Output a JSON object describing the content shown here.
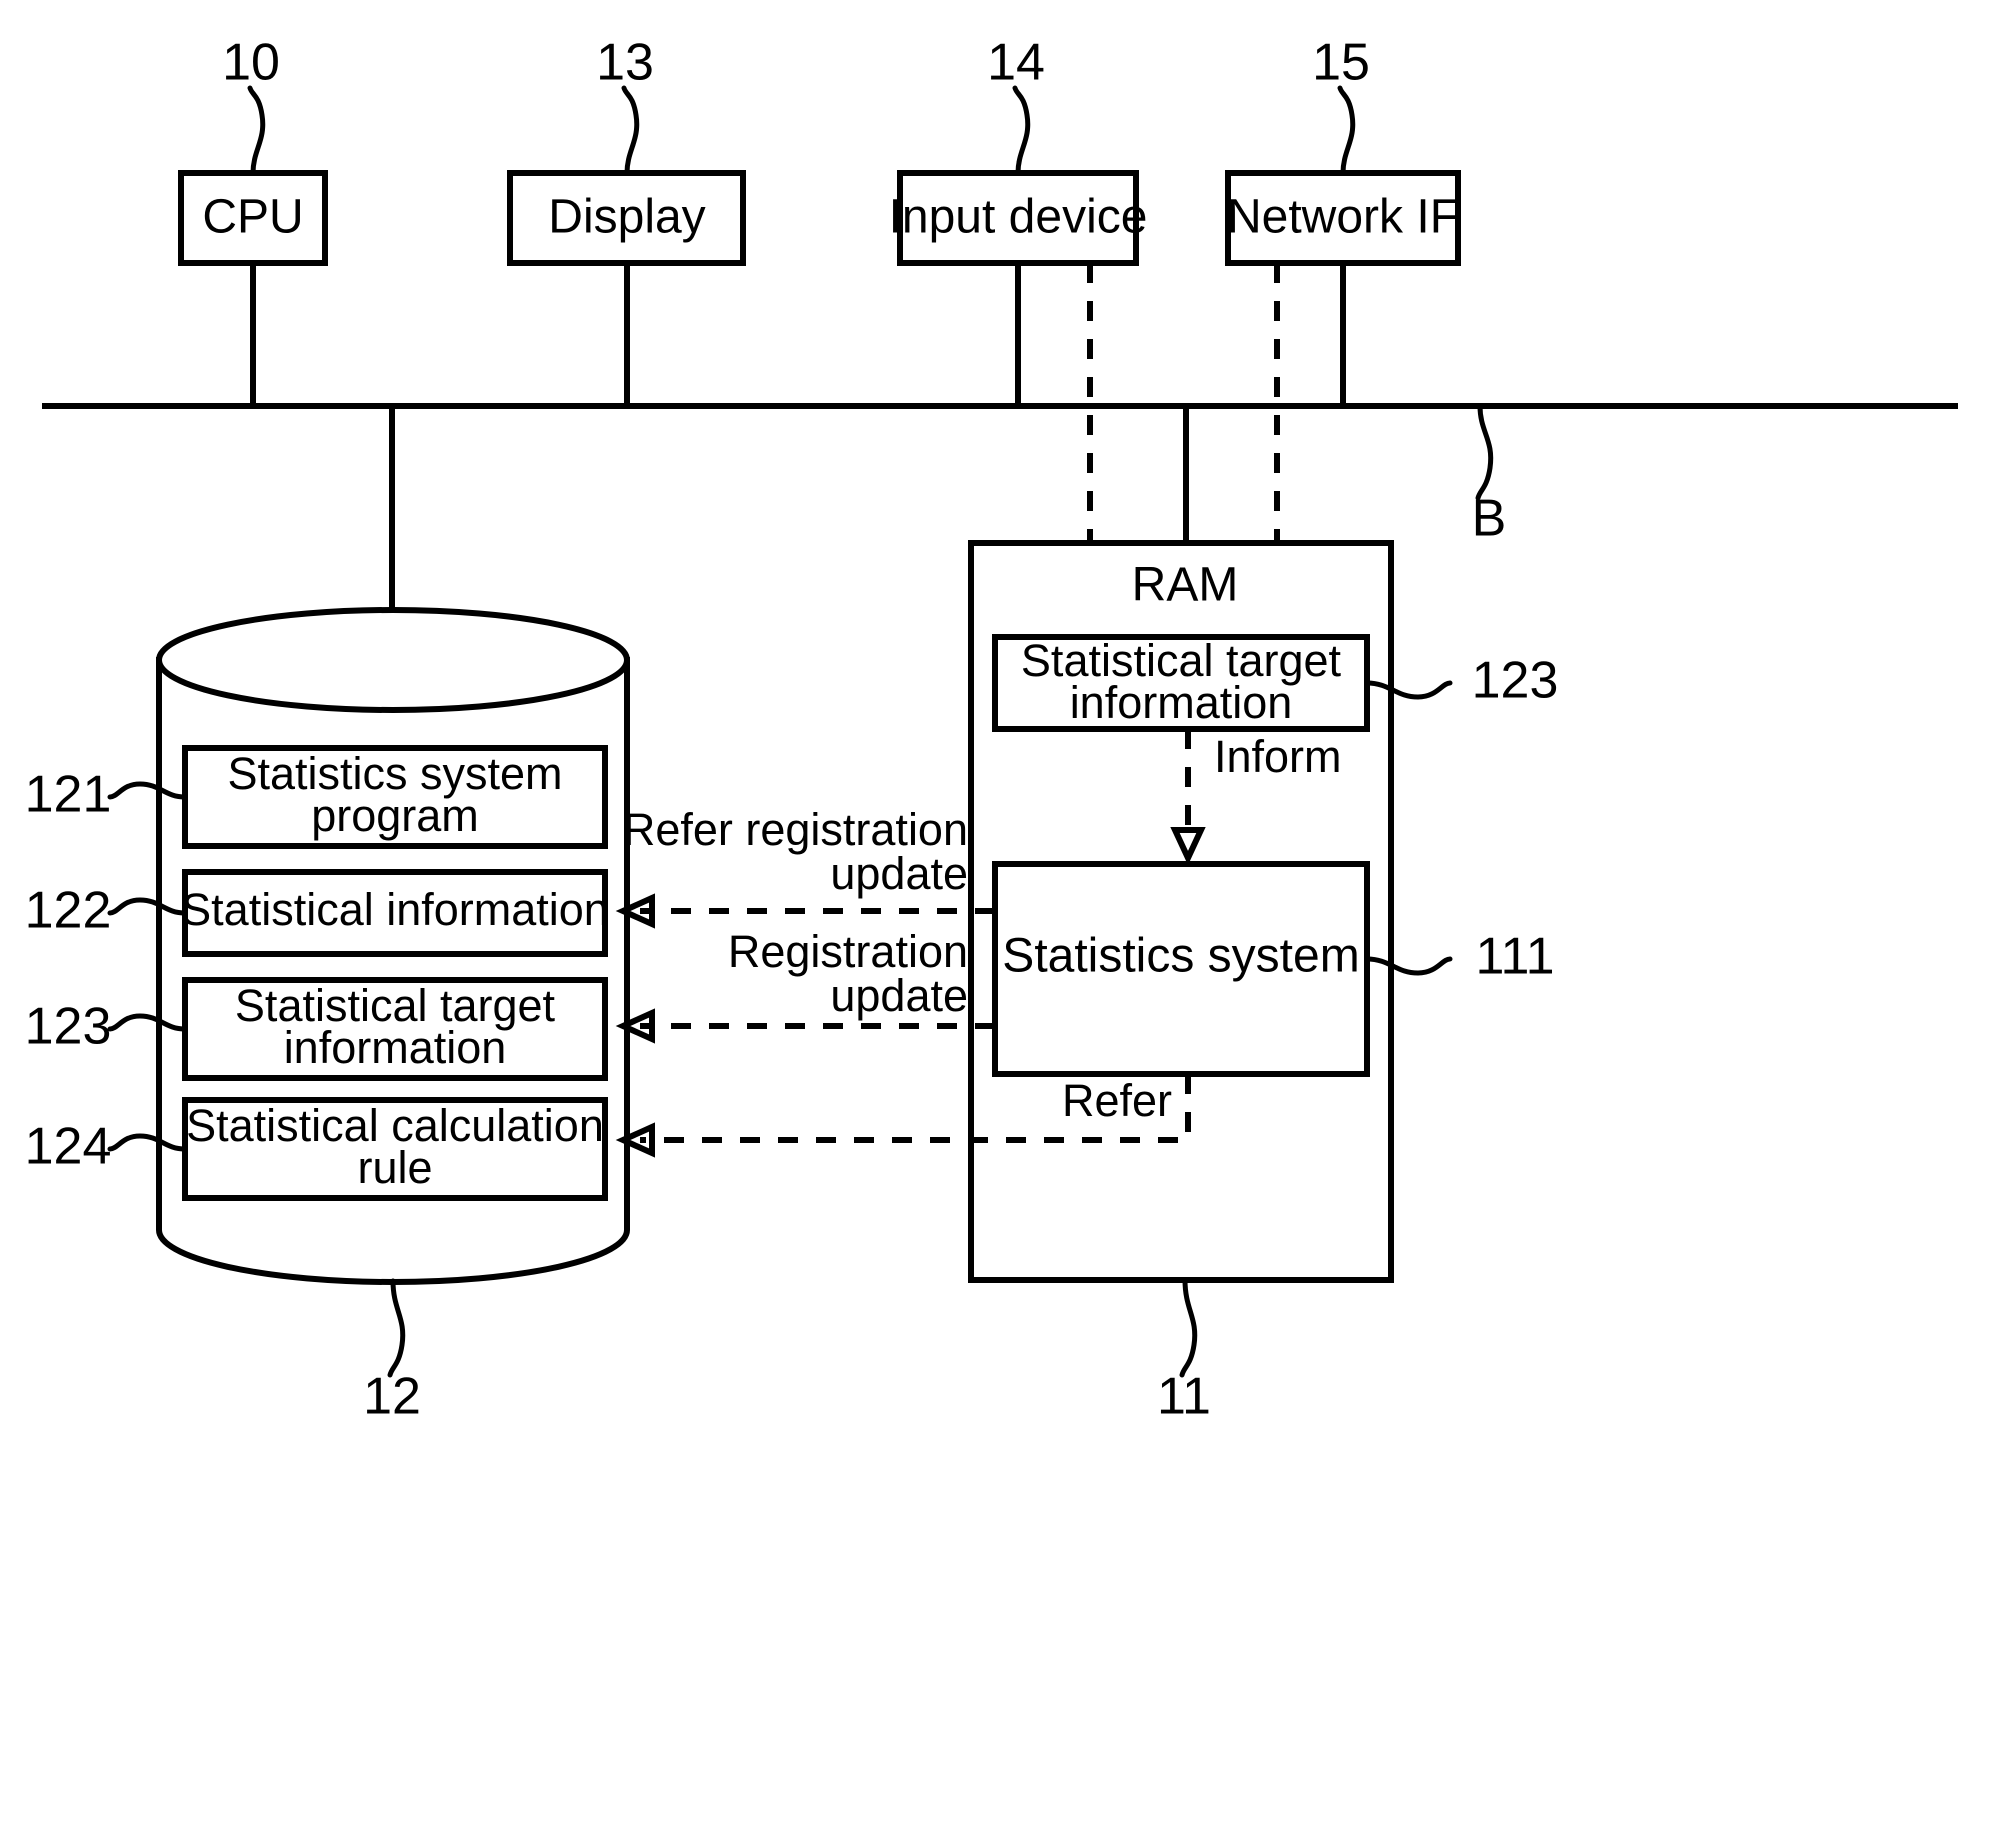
{
  "figure": {
    "type": "patent-block-diagram",
    "description": "Computer hardware block diagram showing CPU, Display, Input device, Network IF connected via bus B to storage (12) and RAM (11)"
  },
  "top_components": [
    {
      "label": "CPU",
      "ref": "10"
    },
    {
      "label": "Display",
      "ref": "13"
    },
    {
      "label": "Input device",
      "ref": "14"
    },
    {
      "label": "Network IF",
      "ref": "15"
    }
  ],
  "bus": {
    "label": "B"
  },
  "storage": {
    "ref": "12",
    "items": [
      {
        "ref": "121",
        "label_line1": "Statistics system",
        "label_line2": "program"
      },
      {
        "ref": "122",
        "label_line1": "Statistical information",
        "label_line2": ""
      },
      {
        "ref": "123",
        "label_line1": "Statistical target",
        "label_line2": "information"
      },
      {
        "ref": "124",
        "label_line1": "Statistical calculation",
        "label_line2": "rule"
      }
    ]
  },
  "ram": {
    "ref": "11",
    "title": "RAM",
    "target_info": {
      "ref": "123",
      "label_line1": "Statistical target",
      "label_line2": "information"
    },
    "statistics_system": {
      "ref": "111",
      "label": "Statistics system"
    }
  },
  "flow_labels": {
    "inform": "Inform",
    "refer_registration_update_line1": "Refer registration",
    "refer_registration_update_line2": "update",
    "registration_update_line1": "Registration",
    "registration_update_line2": "update",
    "refer": "Refer"
  },
  "colors": {
    "stroke": "#000000",
    "background": "#ffffff"
  }
}
